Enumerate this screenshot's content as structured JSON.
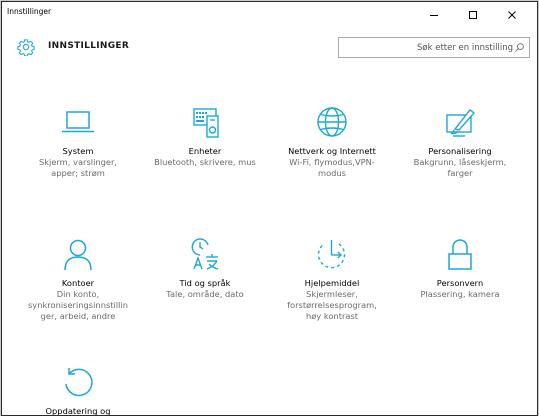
{
  "window": {
    "title": "Innstillinger",
    "controls": {
      "minimize": "minimize-icon",
      "maximize": "maximize-icon",
      "close": "close-icon"
    }
  },
  "header": {
    "title": "INNSTILLINGER",
    "icon": "gear-icon",
    "search_placeholder": "Søk etter en innstilling"
  },
  "colors": {
    "accent": "#1ea7d6",
    "text": "#000000",
    "subtext": "#6b6b6b",
    "border": "#2b2b2b"
  },
  "tiles": [
    {
      "icon": "laptop-icon",
      "title": "System",
      "desc": "Skjerm, varslinger,\napper; strøm"
    },
    {
      "icon": "devices-icon",
      "title": "Enheter",
      "desc": "Bluetooth, skrivere, mus"
    },
    {
      "icon": "globe-icon",
      "title": "Nettverk og Internett",
      "desc": "Wi-Fi, flymodus,VPN-\nmodus"
    },
    {
      "icon": "paint-icon",
      "title": "Personalisering",
      "desc": "Bakgrunn, låseskjerm,\nfarger"
    },
    {
      "icon": "person-icon",
      "title": "Kontoer",
      "desc": "Din konto,\nsynkroniseringsinnstillin\nger, arbeid, andre"
    },
    {
      "icon": "time-language-icon",
      "title": "Tid og språk",
      "desc": "Tale, område, dato"
    },
    {
      "icon": "ease-of-access-icon",
      "title": "Hjelpemiddel",
      "desc": "Skjermleser,\nforstørrelsesprogram,\nhøy kontrast"
    },
    {
      "icon": "lock-icon",
      "title": "Personvern",
      "desc": "Plassering, kamera"
    },
    {
      "icon": "update-icon",
      "title": "Oppdatering og",
      "desc": ""
    }
  ]
}
